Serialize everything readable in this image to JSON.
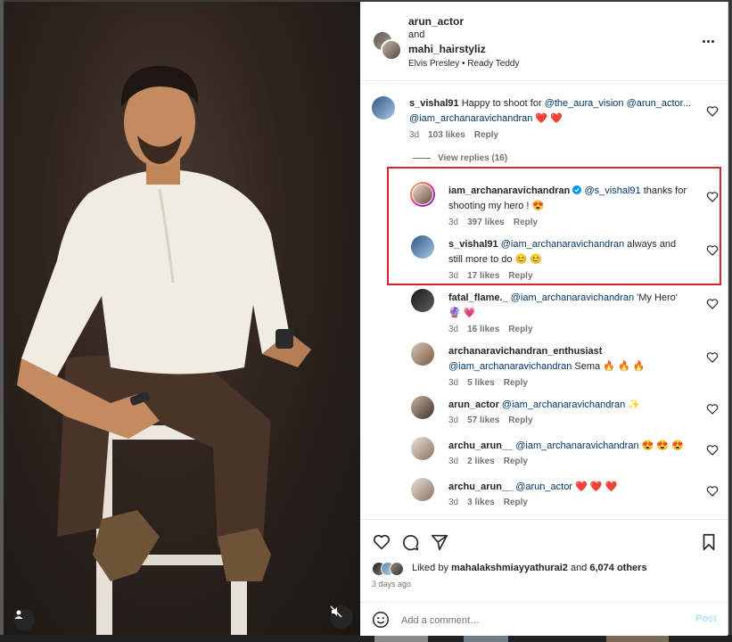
{
  "post": {
    "author1": "arun_actor",
    "and_text": "and",
    "author2": "mahi_hairstyliz",
    "audio": "Elvis Presley • Ready Teddy"
  },
  "comments": [
    {
      "user": "s_vishal91",
      "text_before": "Happy to shoot for ",
      "mentions": [
        "@the_aura_vision",
        "@arun_actor...",
        "@iam_archanaravichandran"
      ],
      "text_after": " ❤️ ❤️",
      "time": "3d",
      "likes": "103 likes",
      "reply": "Reply"
    },
    {
      "user": "iam_archanaravichandran",
      "verified": true,
      "mention": "@s_vishal91",
      "text": " thanks for shooting my hero ! 😍",
      "time": "3d",
      "likes": "397 likes",
      "reply": "Reply"
    },
    {
      "user": "s_vishal91",
      "mention": "@iam_archanaravichandran",
      "text": " always and still more to do 😊 😊",
      "time": "3d",
      "likes": "17 likes",
      "reply": "Reply"
    },
    {
      "user": "fatal_flame._",
      "mention": "@iam_archanaravichandran",
      "text": " 'My Hero' 🔮 💗",
      "time": "3d",
      "likes": "16 likes",
      "reply": "Reply"
    },
    {
      "user": "archanaravichandran_enthusiast",
      "mention": "@iam_archanaravichandran",
      "text": " Sema 🔥 🔥 🔥",
      "time": "3d",
      "likes": "5 likes",
      "reply": "Reply"
    },
    {
      "user": "arun_actor",
      "mention": "@iam_archanaravichandran",
      "text": " ✨",
      "time": "3d",
      "likes": "57 likes",
      "reply": "Reply"
    },
    {
      "user": "archu_arun__",
      "mention": "@iam_archanaravichandran",
      "text": " 😍 😍 😍",
      "time": "3d",
      "likes": "2 likes",
      "reply": "Reply"
    },
    {
      "user": "archu_arun__",
      "mention": "@arun_actor",
      "text": " ❤️ ❤️ ❤️",
      "time": "3d",
      "likes": "3 likes",
      "reply": "Reply"
    }
  ],
  "view_replies": "View replies (16)",
  "footer": {
    "liked_by_prefix": "Liked by ",
    "liked_by_user": "mahalakshmiayyathurai2",
    "liked_by_suffix": " and ",
    "others": "6,074 others",
    "time": "3 days ago",
    "comment_placeholder": "Add a comment…",
    "post_label": "Post"
  },
  "icons": [
    "heart-icon",
    "comment-icon",
    "share-icon",
    "bookmark-icon",
    "emoji-icon",
    "more-icon",
    "user-tag-icon",
    "muted-icon",
    "verified-icon"
  ],
  "colors": {
    "mention": "#00376b",
    "verified": "#0095f6",
    "highlight": "#e0202a",
    "post_disabled": "#b2dffc"
  }
}
